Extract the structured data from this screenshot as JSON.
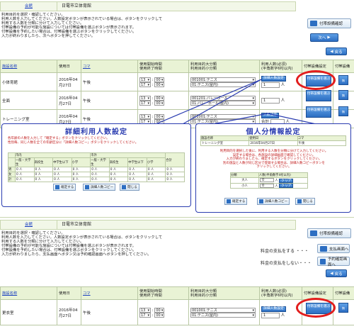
{
  "section1": {
    "header": {
      "link": "会館",
      "facility": "日電市立体育館"
    },
    "instructions": [
      "利用目的を選択・確認してください。",
      "利用人数を入力してください。人数設定ボタンが表示されている場合は、ボタンをクリックして",
      "利用する人数を分類に分けて入力してください。",
      "付帯設備の予約が可能な施設については付帯設備を選ぶボタンが表示されます。",
      "付帯設備を予約したい場合は、付帯設備を選ぶボタンをクリックしてください。",
      "入力が終わりましたら、次へボタンを押してください。"
    ],
    "check_button": "付帯設備確認",
    "next_button": "次へ",
    "back_button": "戻る",
    "columns": [
      "施設名称",
      "使用日",
      "コマ",
      "使用開始時間\n使用終了時間",
      "利用目的大分類\n利用目的小分類",
      "利用人数(必須)\n(半角数字6桁以内)",
      "付帯設備設定",
      "付帯設備"
    ],
    "rows": [
      {
        "name": "小体育館",
        "date": "2016年04月27日",
        "koma": "午後",
        "start_h": "13",
        "start_m": "00",
        "end_h": "17",
        "end_m": "00",
        "purpose_major": "001001:テニス",
        "purpose_minor": "01:テニス(屋内)",
        "people_button": "詳細人数設定",
        "people": "1",
        "unit": "人",
        "equip_button": "付帯設備を選ぶ",
        "none_label": "無"
      },
      {
        "name": "全面",
        "date": "2016年04月27日",
        "koma": "午後",
        "start_h": "13",
        "start_m": "00",
        "end_h": "17",
        "end_m": "00",
        "purpose_major": "001201:バレーボール",
        "purpose_minor": "01:バレーボール(屋内)",
        "people_button": "",
        "people": "1",
        "unit": "人",
        "equip_button": "付帯設備を選ぶ",
        "none_label": "無"
      },
      {
        "name": "トレーニング室",
        "date": "2016年04月27日",
        "koma": "午後",
        "start_h": "13",
        "start_m": "00",
        "end_h": "17",
        "end_m": "00",
        "purpose_major": "001001:テニス",
        "purpose_minor": "01:テニス(屋内)",
        "people_button": "人数設定",
        "people": "",
        "unit": "人",
        "total_label": "合計",
        "equip_button": "付帯設備を選ぶ",
        "none_label": "無"
      }
    ]
  },
  "detail_panel": {
    "title": "詳細利用人数設定",
    "note1": "各年齢の人数を入力して「確定する」ボタンをクリックしてください。",
    "note2": "性別毎、同じ人数を全ての年齢区分に「詳細人数コピー」ボタンをクリックしてください。",
    "groups": [
      "市内",
      "市外"
    ],
    "subcols": [
      "一般・大学生",
      "高校生",
      "中学生以下",
      "小学",
      "一般・大学生",
      "高校生",
      "中学生以下",
      "小学"
    ],
    "total_col": "合計",
    "rows": [
      "男",
      "女",
      "計"
    ],
    "zero": "0",
    "unit": "人",
    "confirm": "確定する",
    "copy": "詳細人数コピー",
    "close": "閉じる"
  },
  "individual_panel": {
    "title": "個人分情報設定",
    "col_name": "施設名称",
    "col_date": "使用日",
    "col_koma": "コマ",
    "name": "トレーニング室",
    "date": "2016年04月27日",
    "koma": "午後",
    "note": [
      "利用目的を選択した後に、利用する人数を分類に分けて入力してください。",
      "設定する場合は、各施設の詳細画面で確認してください。",
      "入力が終わりましたら、確定するボタンをクリックしてください。",
      "別の施設と人数が同じ区分で登録する場合は、詳細人数コピーボタンを",
      "クリックしてください。"
    ],
    "th_class": "分類",
    "th_count": "人数(半角数字4桁以内)",
    "rows": [
      {
        "label": "大人",
        "value": "0",
        "unit": "人",
        "btn": "クリア"
      },
      {
        "label": "小人",
        "value": "0",
        "unit": "人",
        "btn": "クリア"
      }
    ],
    "confirm": "確定する",
    "copy": "詳細人数コピー",
    "close": "閉じる"
  },
  "section2": {
    "header": {
      "link": "会館",
      "facility": "日電市立体育館"
    },
    "instructions": [
      "利用目的を選択・確認してください。",
      "利用人数を入力してください。人数設定ボタンが表示されている場合は、ボタンをクリックして",
      "利用する人数を分類に分けて入力してください。",
      "付帯設備の予約が可能な施設については付帯設備を選ぶボタンが表示されます。",
      "付帯設備を予約したい場合は、付帯設備を選ぶボタンをクリックしてください。",
      "入力が終わりましたら、支払画面へボタン又は予約確認画面へボタンを押してください。"
    ],
    "check_button": "付帯設備確認",
    "pay_text": "料金の支払をする ・・・",
    "pay_button": "支払画面へ",
    "nopay_text": "料金の支払をしない・・・",
    "nopay_button": "予約確認画面へ",
    "back_button": "戻る",
    "row": {
      "name": "更衣室",
      "date": "2016年04月27日",
      "koma": "午後",
      "start_h": "13",
      "start_m": "00",
      "end_h": "17",
      "end_m": "00",
      "purpose_major": "001001:テニス",
      "purpose_minor": "01:テニス(屋内)",
      "people_button": "詳細人数設定",
      "people": "1",
      "unit": "人",
      "equip_button": "付帯設備を選ぶ",
      "none_label": "無"
    }
  },
  "colors": {
    "accent": "#2c6ec2",
    "highlight": "#e21d1d",
    "panel": "#2a3cb0",
    "header_bg": "#e9f3d5"
  }
}
